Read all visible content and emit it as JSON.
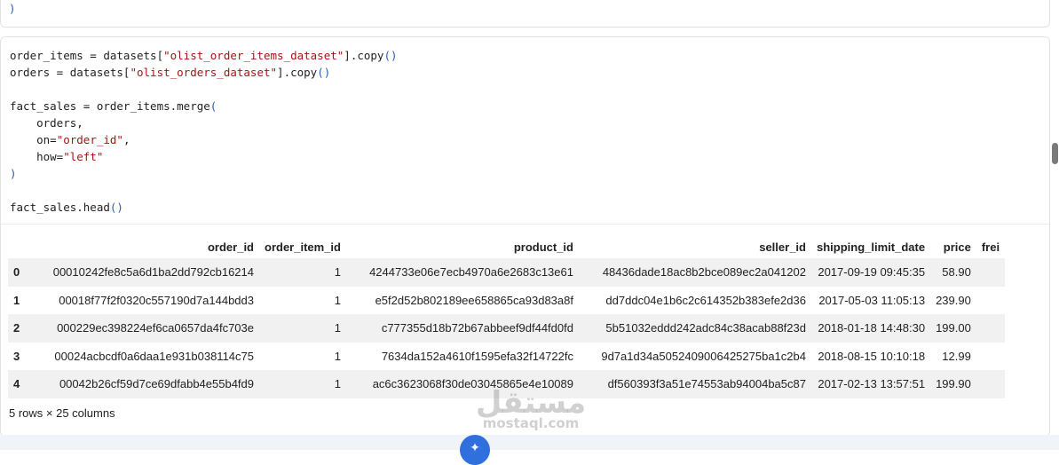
{
  "previous_cell": {
    "last_line": ")"
  },
  "code_cell": {
    "line1_a": "order_items = datasets[",
    "line1_s": "\"olist_order_items_dataset\"",
    "line1_b": "].copy",
    "line1_p": "()",
    "line2_a": "orders = datasets[",
    "line2_s": "\"olist_orders_dataset\"",
    "line2_b": "].copy",
    "line2_p": "()",
    "line4_a": "fact_sales = order_items.merge",
    "line4_p": "(",
    "line5": "    orders,",
    "line6_a": "    on=",
    "line6_s": "\"order_id\"",
    "line6_b": ",",
    "line7_a": "    how=",
    "line7_s": "\"left\"",
    "line8_p": ")",
    "line10_a": "fact_sales.head",
    "line10_p": "()"
  },
  "table": {
    "columns": [
      "",
      "order_id",
      "order_item_id",
      "product_id",
      "seller_id",
      "shipping_limit_date",
      "price",
      "frei"
    ],
    "rows": [
      [
        "0",
        "00010242fe8c5a6d1ba2dd792cb16214",
        "1",
        "4244733e06e7ecb4970a6e2683c13e61",
        "48436dade18ac8b2bce089ec2a041202",
        "2017-09-19 09:45:35",
        "58.90",
        ""
      ],
      [
        "1",
        "00018f77f2f0320c557190d7a144bdd3",
        "1",
        "e5f2d52b802189ee658865ca93d83a8f",
        "dd7ddc04e1b6c2c614352b383efe2d36",
        "2017-05-03 11:05:13",
        "239.90",
        ""
      ],
      [
        "2",
        "000229ec398224ef6ca0657da4fc703e",
        "1",
        "c777355d18b72b67abbeef9df44fd0fd",
        "5b51032eddd242adc84c38acab88f23d",
        "2018-01-18 14:48:30",
        "199.00",
        ""
      ],
      [
        "3",
        "00024acbcdf0a6daa1e931b038114c75",
        "1",
        "7634da152a4610f1595efa32f14722fc",
        "9d7a1d34a5052409006425275ba1c2b4",
        "2018-08-15 10:10:18",
        "12.99",
        ""
      ],
      [
        "4",
        "00042b26cf59d7ce69dfabb4e55b4fd9",
        "1",
        "ac6c3623068f30de03045865e4e10089",
        "df560393f3a51e74553ab94004ba5c87",
        "2017-02-13 13:57:51",
        "199.90",
        ""
      ]
    ],
    "summary": "5 rows × 25 columns"
  },
  "watermark": {
    "arabic": "مستقل",
    "latin": "mostaql.com"
  },
  "fab": {
    "icon": "sparkle-icon"
  }
}
